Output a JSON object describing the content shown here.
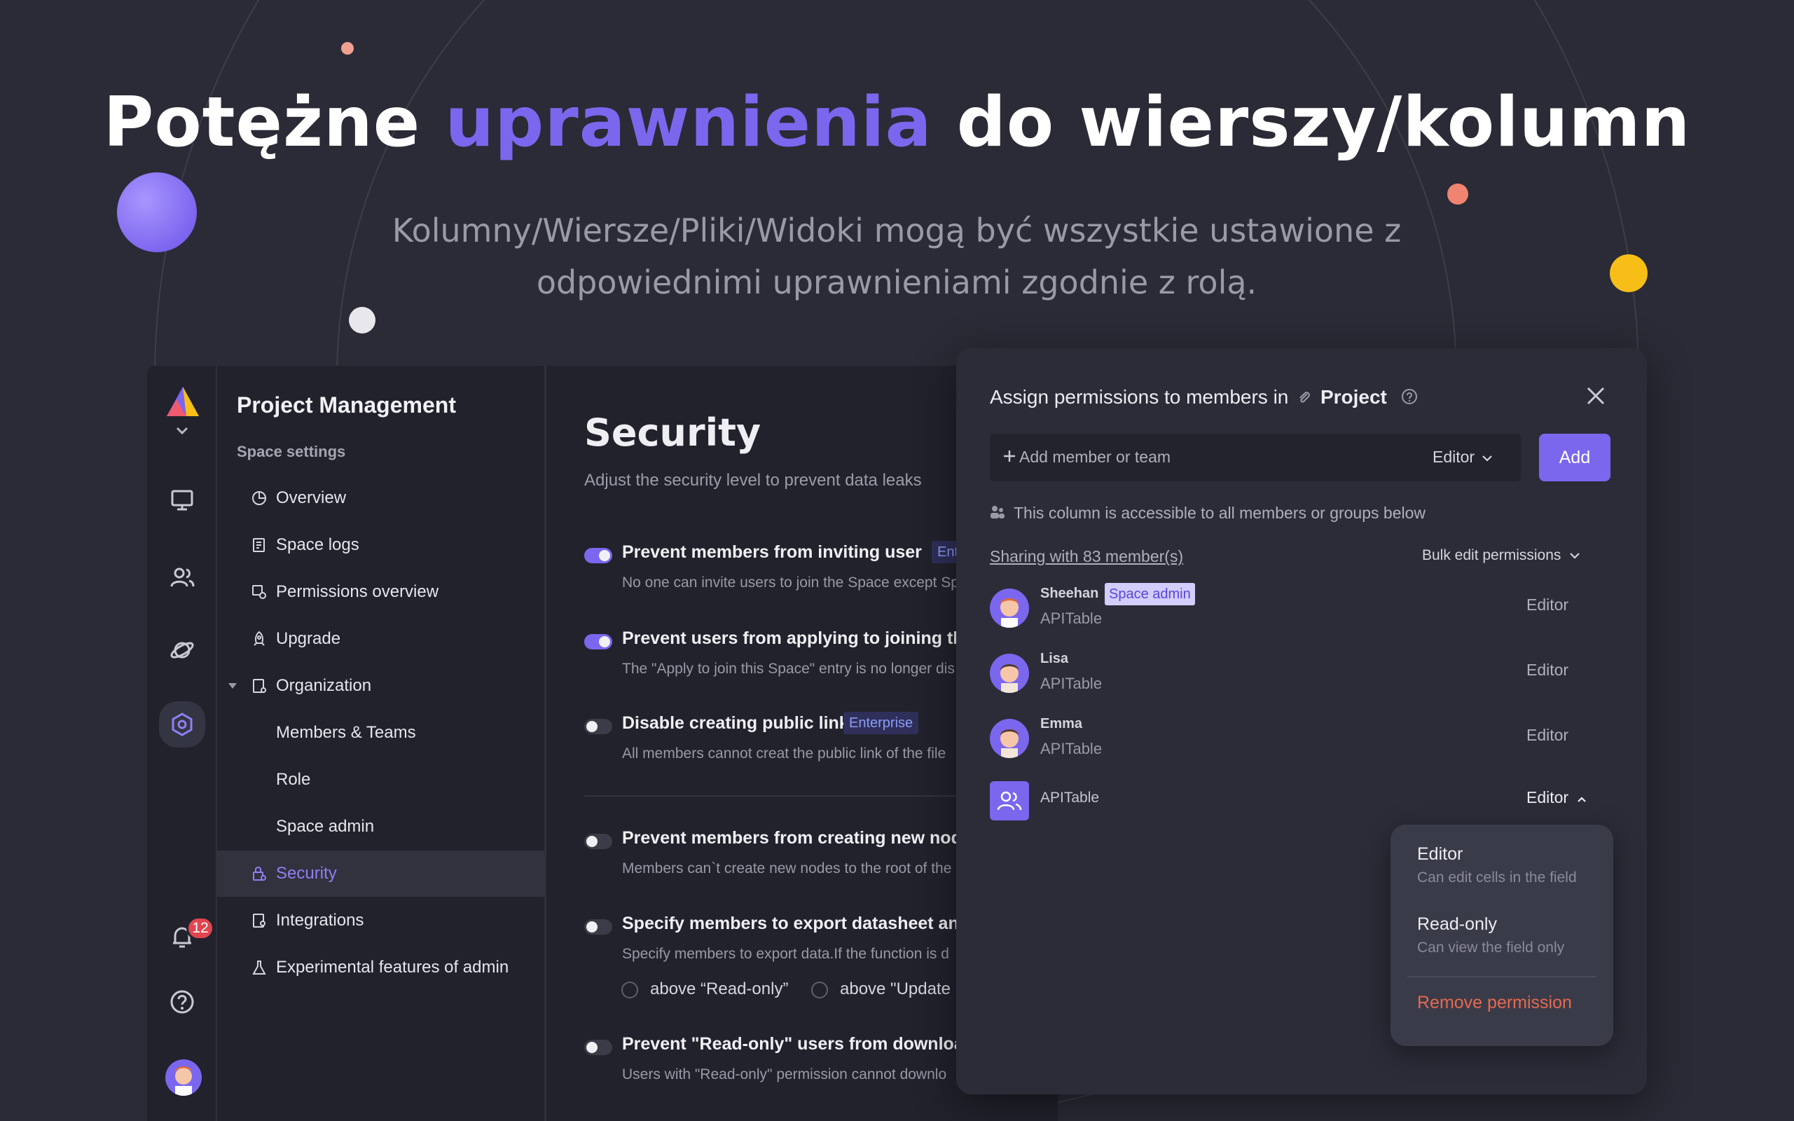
{
  "hero": {
    "title_before": "Potężne",
    "title_accent": "uprawnienia",
    "title_after": "do wierszy/kolumn",
    "subtitle_line1": "Kolumny/Wiersze/Pliki/Widoki mogą być wszystkie ustawione z",
    "subtitle_line2": "odpowiednimi uprawnieniami zgodnie z rolą."
  },
  "colors": {
    "accent": "#7b67ee",
    "background": "#2a2b36",
    "panel": "#21222c",
    "modal": "#2b2c38",
    "danger": "#e6694f",
    "badge": "#e0454f"
  },
  "rail": {
    "icons": [
      "logo-icon",
      "monitor-icon",
      "contacts-icon",
      "planet-icon",
      "settings-hex-icon",
      "bell-icon",
      "help-icon",
      "avatar"
    ],
    "notification_count": "12"
  },
  "settings": {
    "title": "Project Management",
    "section": "Space settings",
    "items": [
      {
        "label": "Overview",
        "icon": "pie-icon"
      },
      {
        "label": "Space logs",
        "icon": "log-icon"
      },
      {
        "label": "Permissions overview",
        "icon": "permissions-icon"
      },
      {
        "label": "Upgrade",
        "icon": "rocket-icon"
      },
      {
        "label": "Organization",
        "icon": "org-icon"
      },
      {
        "label": "Members & Teams"
      },
      {
        "label": "Role"
      },
      {
        "label": "Space admin"
      },
      {
        "label": "Security",
        "icon": "lock-icon"
      },
      {
        "label": "Integrations",
        "icon": "integrations-icon"
      },
      {
        "label": "Experimental features of admin",
        "icon": "flask-icon"
      }
    ]
  },
  "security": {
    "title": "Security",
    "description": "Adjust the security level to prevent data leaks",
    "options": [
      {
        "label": "Prevent members from inviting user",
        "tag": "Enter",
        "hint": "No one can invite users to join the Space except Sp",
        "on": true
      },
      {
        "label": "Prevent users from applying to joining the S",
        "hint": "The \"Apply to join this Space\" entry is no longer dis",
        "on": true
      },
      {
        "label": "Disable creating public link",
        "tag": "Enterprise",
        "hint": "All members cannot creat the public link of the file",
        "on": false
      },
      {
        "label": "Prevent members from creating new nodes",
        "hint": "Members can`t create new nodes to the root of the",
        "on": false
      },
      {
        "label": "Specify members to export datasheet and v",
        "hint": "Specify members to export data.If the function is d",
        "on": false
      },
      {
        "label": "Prevent \"Read-only\" users from downloadin",
        "hint": "Users with \"Read-only\" permission cannot downlo",
        "on": false
      }
    ],
    "radio_options": [
      "above “Read-only”",
      "above \"Update"
    ]
  },
  "modal": {
    "title_prefix": "Assign permissions to members in",
    "title_object": "Project",
    "add_placeholder": "Add member or team",
    "role_select": "Editor",
    "add_button": "Add",
    "access_note": "This column is accessible to all members or groups below",
    "sharing_link": "Sharing with 83 member(s)",
    "bulk_edit": "Bulk edit permissions",
    "members": [
      {
        "name": "Sheehan",
        "badge": "Space admin",
        "org": "APITable",
        "role": "Editor"
      },
      {
        "name": "Lisa",
        "org": "APITable",
        "role": "Editor"
      },
      {
        "name": "Emma",
        "org": "APITable",
        "role": "Editor"
      },
      {
        "name": "",
        "org": "APITable",
        "role": "Editor"
      }
    ],
    "dropdown": {
      "editor_label": "Editor",
      "editor_desc": "Can edit cells in the field",
      "readonly_label": "Read-only",
      "readonly_desc": "Can view the field only",
      "remove_label": "Remove permission"
    }
  }
}
